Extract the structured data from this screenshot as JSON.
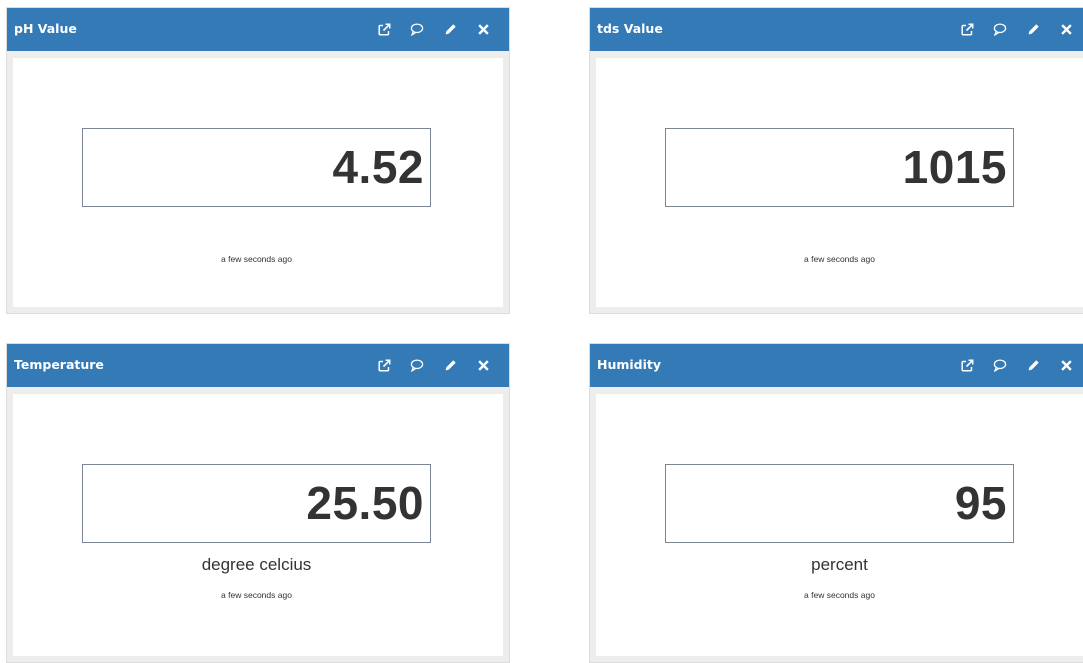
{
  "widgets": [
    {
      "title": "pH Value",
      "value": "4.52",
      "unit": "",
      "timestamp": "a few seconds ago"
    },
    {
      "title": "tds Value",
      "value": "1015",
      "unit": "",
      "timestamp": "a few seconds ago"
    },
    {
      "title": "Temperature",
      "value": "25.50",
      "unit": "degree celcius",
      "timestamp": "a few seconds ago"
    },
    {
      "title": "Humidity",
      "value": "95",
      "unit": "percent",
      "timestamp": "a few seconds ago"
    }
  ],
  "tool_icons": [
    "external-link-icon",
    "comment-icon",
    "pencil-icon",
    "close-icon"
  ],
  "colors": {
    "header": "#337ab7",
    "header_text": "#ffffff",
    "frame": "#ededed",
    "value_border": "#7b8593",
    "text": "#333333"
  }
}
